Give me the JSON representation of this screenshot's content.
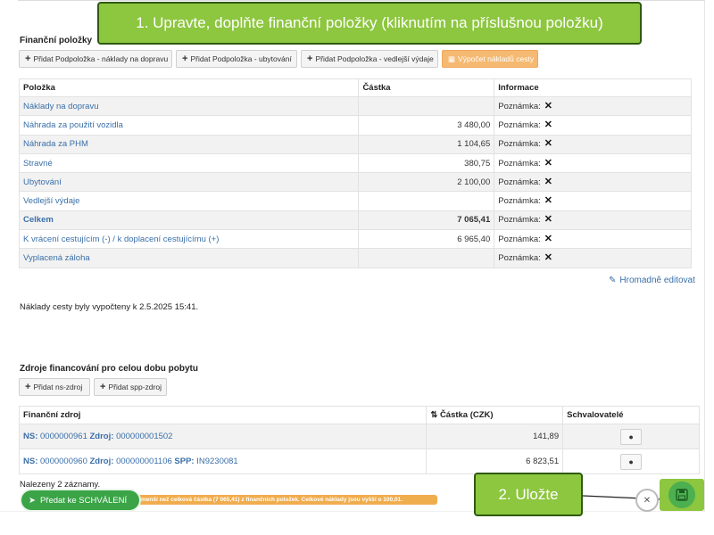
{
  "callouts": {
    "step1": "1. Upravte, doplňte finanční položky (kliknutím na příslušnou položku)",
    "step2": "2. Uložte"
  },
  "financial": {
    "title": "Finanční položky",
    "buttons": {
      "add_transport": "Přidat Podpoložka - náklady na dopravu",
      "add_accommodation": "Přidat Podpoložka - ubytování",
      "add_side": "Přidat Podpoložka - vedlejší výdaje",
      "compute": "Výpočet nákladů cesty"
    },
    "columns": {
      "item": "Položka",
      "amount": "Částka",
      "info": "Informace"
    },
    "rows": [
      {
        "item": "Náklady na dopravu",
        "amount": "",
        "note": "Poznámka:"
      },
      {
        "item": "Náhrada za použití vozidla",
        "amount": "3 480,00",
        "note": "Poznámka:"
      },
      {
        "item": "Náhrada za PHM",
        "amount": "1 104,65",
        "note": "Poznámka:"
      },
      {
        "item": "Stravné",
        "amount": "380,75",
        "note": "Poznámka:"
      },
      {
        "item": "Ubytování",
        "amount": "2 100,00",
        "note": "Poznámka:"
      },
      {
        "item": "Vedlejší výdaje",
        "amount": "",
        "note": "Poznámka:"
      },
      {
        "item": "Celkem",
        "amount": "7 065,41",
        "note": "Poznámka:"
      },
      {
        "item": "K vrácení cestujícím (-) / k doplacení cestujícímu (+)",
        "amount": "6 965,40",
        "note": "Poznámka:"
      },
      {
        "item": "Vyplacená záloha",
        "amount": "",
        "note": "Poznámka:"
      }
    ],
    "bulk_edit": "Hromadně editovat",
    "computed_text": "Náklady cesty byly vypočteny k 2.5.2025 15:41."
  },
  "funding": {
    "title": "Zdroje financování pro celou dobu pobytu",
    "buttons": {
      "add_ns": "Přidat ns-zdroj",
      "add_spp": "Přidat spp-zdroj"
    },
    "columns": {
      "source": "Finanční zdroj",
      "amount": "Částka (CZK)",
      "approvers": "Schvalovatelé"
    },
    "rows": [
      {
        "ns_label": "NS:",
        "ns": "0000000961",
        "zdroj_label": "Zdroj:",
        "zdroj": "000000001502",
        "spp_label": "",
        "spp": "",
        "amount": "141,89"
      },
      {
        "ns_label": "NS:",
        "ns": "0000000960",
        "zdroj_label": "Zdroj:",
        "zdroj": "000000001106",
        "spp_label": "SPP:",
        "spp": "IN9230081",
        "amount": "6 823,51"
      }
    ],
    "found": "Nalezeny 2 záznamy.",
    "warning": "menší než celková částka (7 065,41) z finančních položek. Celkové náklady jsou vyšší o 100,01."
  },
  "actions": {
    "send_for_approval": "Předat ke SCHVÁLENÍ"
  },
  "colors": {
    "callout_green": "#8dc63f",
    "link_blue": "#3a6fa8",
    "orange": "#f0ad4e",
    "button_green": "#3aa447"
  }
}
